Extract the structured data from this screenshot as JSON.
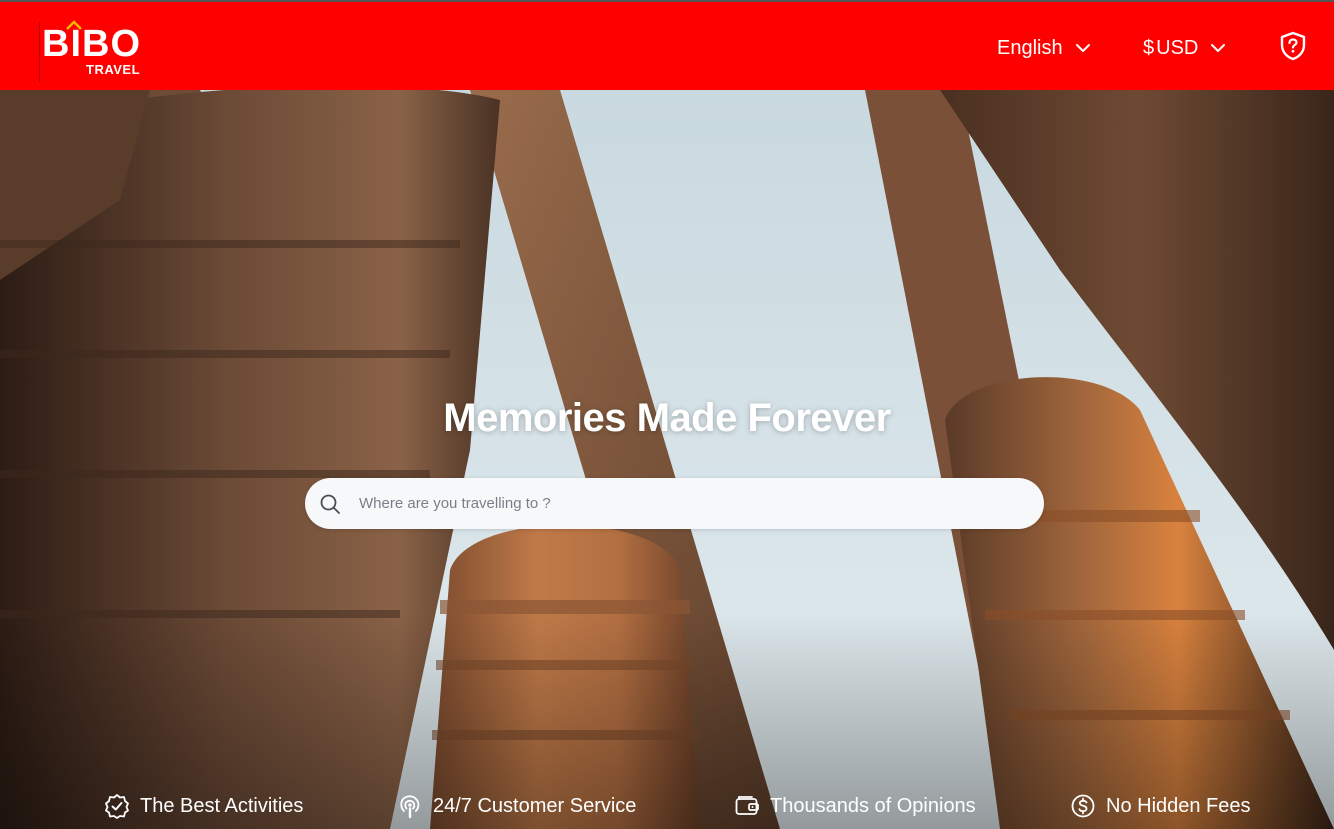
{
  "brand": {
    "name": "BIBO",
    "sub": "TRAVEL",
    "color": "#ff0000"
  },
  "header": {
    "language": {
      "label": "English",
      "icon": "chevron-down-icon"
    },
    "currency": {
      "symbol": "$",
      "label": "USD",
      "icon": "chevron-down-icon"
    },
    "help_icon": "shield-question-icon"
  },
  "hero": {
    "title": "Memories Made Forever",
    "search": {
      "placeholder": "Where are you travelling to ?",
      "value": "",
      "icon": "search-icon"
    }
  },
  "features": [
    {
      "label": "The Best Activities",
      "icon": "badge-check-icon"
    },
    {
      "label": "24/7 Customer Service",
      "icon": "podcast-icon"
    },
    {
      "label": "Thousands of Opinions",
      "icon": "wallet-icon"
    },
    {
      "label": "No Hidden Fees",
      "icon": "dollar-circle-icon"
    }
  ]
}
